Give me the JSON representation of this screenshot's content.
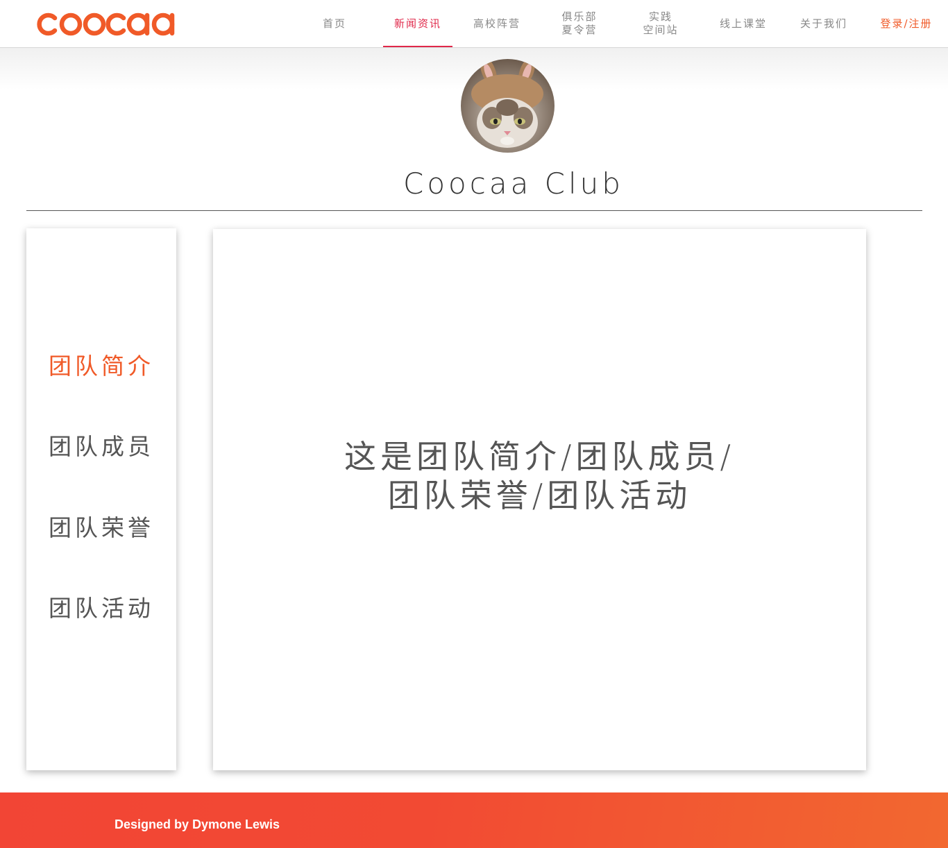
{
  "header": {
    "logo_text": "coocaa",
    "nav": [
      {
        "label": "首页"
      },
      {
        "label": "新闻资讯",
        "active": true
      },
      {
        "label": "高校阵营"
      },
      {
        "line1": "俱乐部",
        "line2": "夏令营"
      },
      {
        "line1": "实践",
        "line2": "空间站"
      },
      {
        "label": "线上课堂"
      },
      {
        "label": "关于我们"
      }
    ],
    "login_label": "登录/注册"
  },
  "banner": {
    "avatar_icon": "cat-avatar-icon",
    "title": "Coocaa Club"
  },
  "sidebar": {
    "items": [
      {
        "label": "团队简介",
        "active": true
      },
      {
        "label": "团队成员"
      },
      {
        "label": "团队荣誉"
      },
      {
        "label": "团队活动"
      }
    ]
  },
  "main": {
    "line1": "这是团队简介/团队成员/",
    "line2": "团队荣誉/团队活动"
  },
  "footer": {
    "text": "Designed by Dymone Lewis"
  },
  "colors": {
    "brand_orange": "#f05a28",
    "nav_active": "#e0284a",
    "footer_red": "#f24535"
  }
}
